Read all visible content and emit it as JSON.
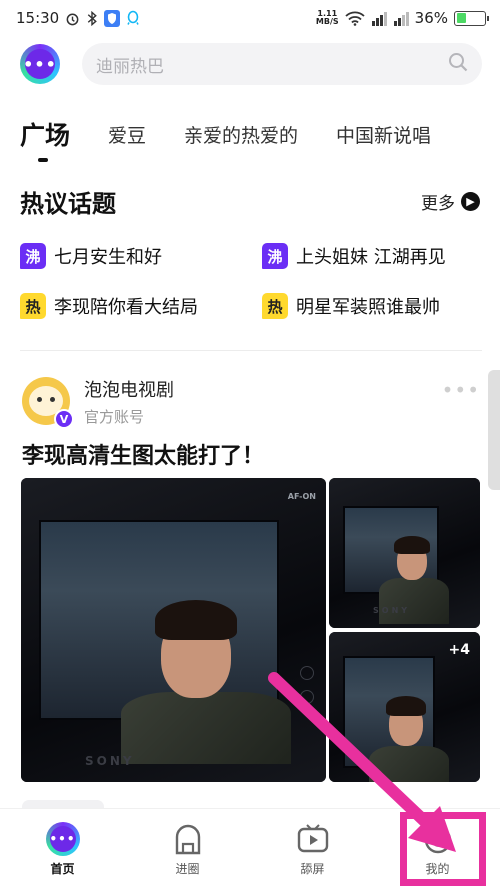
{
  "status_bar": {
    "time": "15:30",
    "net_speed_value": "1.11",
    "net_speed_unit": "MB/S",
    "battery_percent": "36%",
    "battery_level": 0.36
  },
  "header": {
    "search_placeholder": "迪丽热巴"
  },
  "tabs": [
    {
      "label": "广场",
      "active": true
    },
    {
      "label": "爱豆",
      "active": false
    },
    {
      "label": "亲爱的热爱的",
      "active": false
    },
    {
      "label": "中国新说唱",
      "active": false
    }
  ],
  "hot_topics": {
    "title": "热议话题",
    "more_label": "更多",
    "items": [
      {
        "badge": "沸",
        "text": "七月安生和好",
        "kind": "boil"
      },
      {
        "badge": "沸",
        "text": "上头姐妹 江湖再见",
        "kind": "boil"
      },
      {
        "badge": "热",
        "text": "李现陪你看大结局",
        "kind": "hot"
      },
      {
        "badge": "热",
        "text": "明星军装照谁最帅",
        "kind": "hot"
      }
    ]
  },
  "post": {
    "author_name": "泡泡电视剧",
    "author_sub": "官方账号",
    "verified_badge": "V",
    "title": "李现高清生图太能打了！",
    "more_images": "+4",
    "camera_brand": "SONY",
    "camera_label": "AF-ON"
  },
  "bottom_nav": [
    {
      "label": "首页",
      "icon": "home-logo-icon",
      "active": true
    },
    {
      "label": "进圈",
      "icon": "arch-icon",
      "active": false
    },
    {
      "label": "舔屏",
      "icon": "play-screen-icon",
      "active": false
    },
    {
      "label": "我的",
      "icon": "baby-face-icon",
      "active": false
    }
  ],
  "annotation": {
    "color": "#e8309e"
  },
  "colors": {
    "brand_purple": "#6b2ef5",
    "hot_yellow": "#ffd92e"
  }
}
